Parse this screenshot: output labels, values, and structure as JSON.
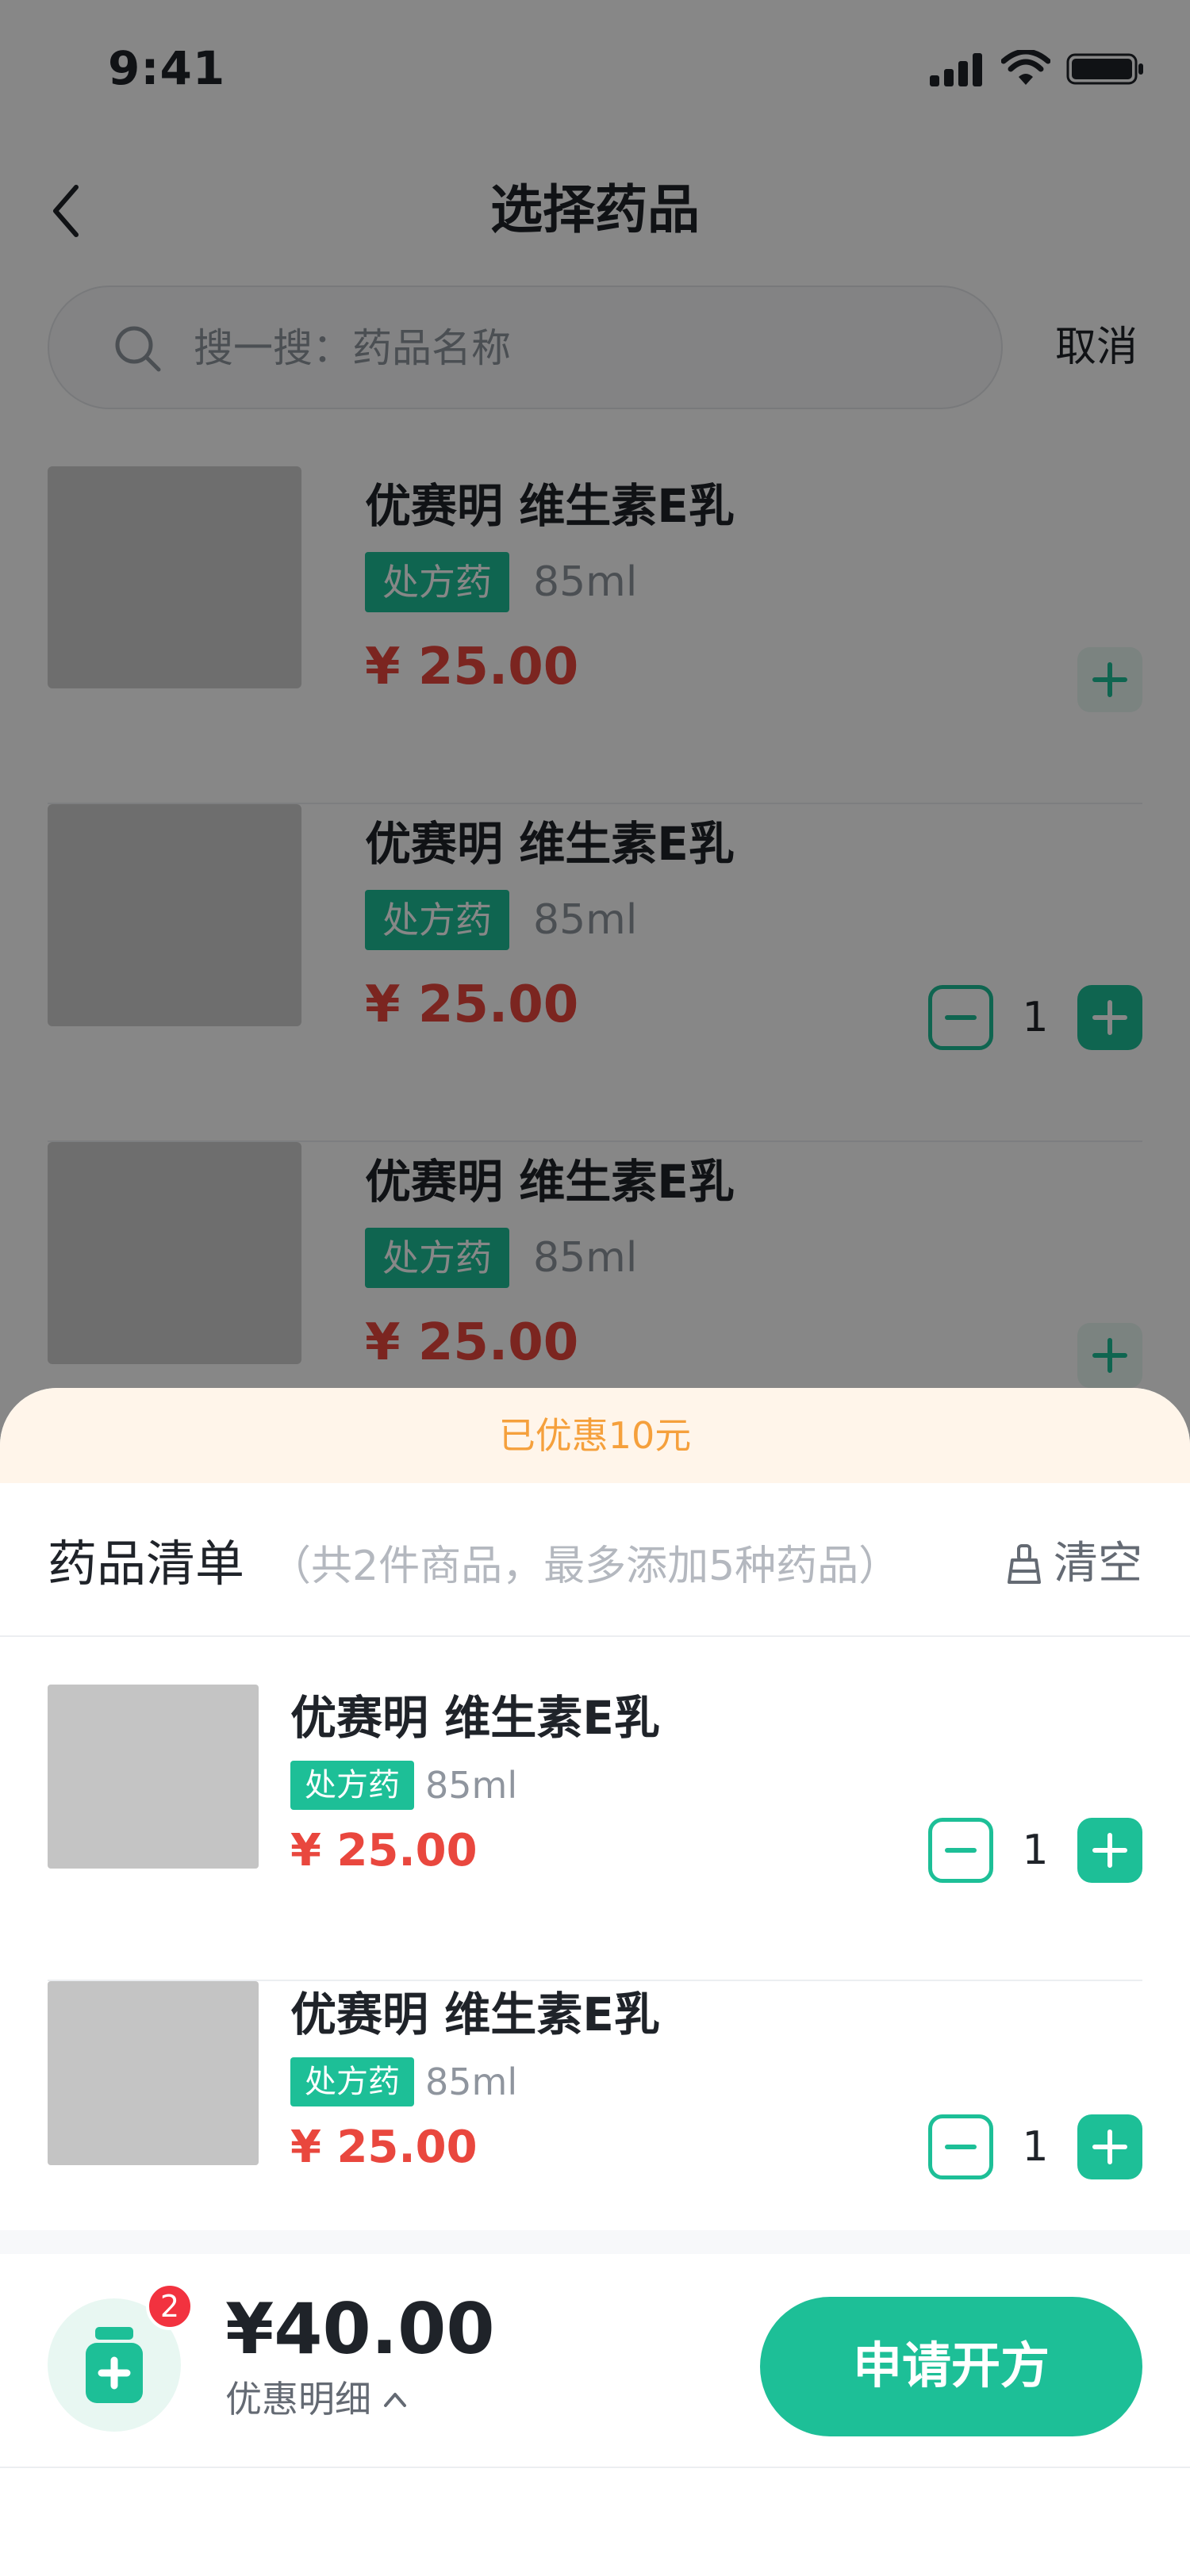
{
  "status_bar": {
    "time": "9:41"
  },
  "nav": {
    "title": "选择药品"
  },
  "search": {
    "placeholder": "搜一搜：药品名称",
    "cancel_label": "取消"
  },
  "products": [
    {
      "name": "优赛明 维生素E乳",
      "tag": "处方药",
      "spec": "85ml",
      "price": "¥ 25.00",
      "quantity": null
    },
    {
      "name": "优赛明 维生素E乳",
      "tag": "处方药",
      "spec": "85ml",
      "price": "¥ 25.00",
      "quantity": "1"
    },
    {
      "name": "优赛明 维生素E乳",
      "tag": "处方药",
      "spec": "85ml",
      "price": "¥ 25.00",
      "quantity": null
    }
  ],
  "sheet": {
    "discount_banner": "已优惠10元",
    "title": "药品清单",
    "note": "（共2件商品，最多添加5种药品）",
    "clear_label": "清空",
    "items": [
      {
        "name": "优赛明 维生素E乳",
        "tag": "处方药",
        "spec": "85ml",
        "price": "¥ 25.00",
        "quantity": "1"
      },
      {
        "name": "优赛明 维生素E乳",
        "tag": "处方药",
        "spec": "85ml",
        "price": "¥ 25.00",
        "quantity": "1"
      }
    ]
  },
  "checkout": {
    "cart_count": "2",
    "total": "¥40.00",
    "detail_label": "优惠明细",
    "apply_label": "申请开方"
  },
  "colors": {
    "accent": "#1dbf97",
    "price": "#e9473e",
    "badge": "#f2323f",
    "discount_text": "#f5a03c",
    "discount_bg": "#fff5ea"
  },
  "icons": [
    "signal-icon",
    "wifi-icon",
    "battery-icon",
    "back-icon",
    "search-icon",
    "plus-icon",
    "minus-icon",
    "broom-icon",
    "medicine-bottle-icon",
    "chevron-up-icon"
  ]
}
